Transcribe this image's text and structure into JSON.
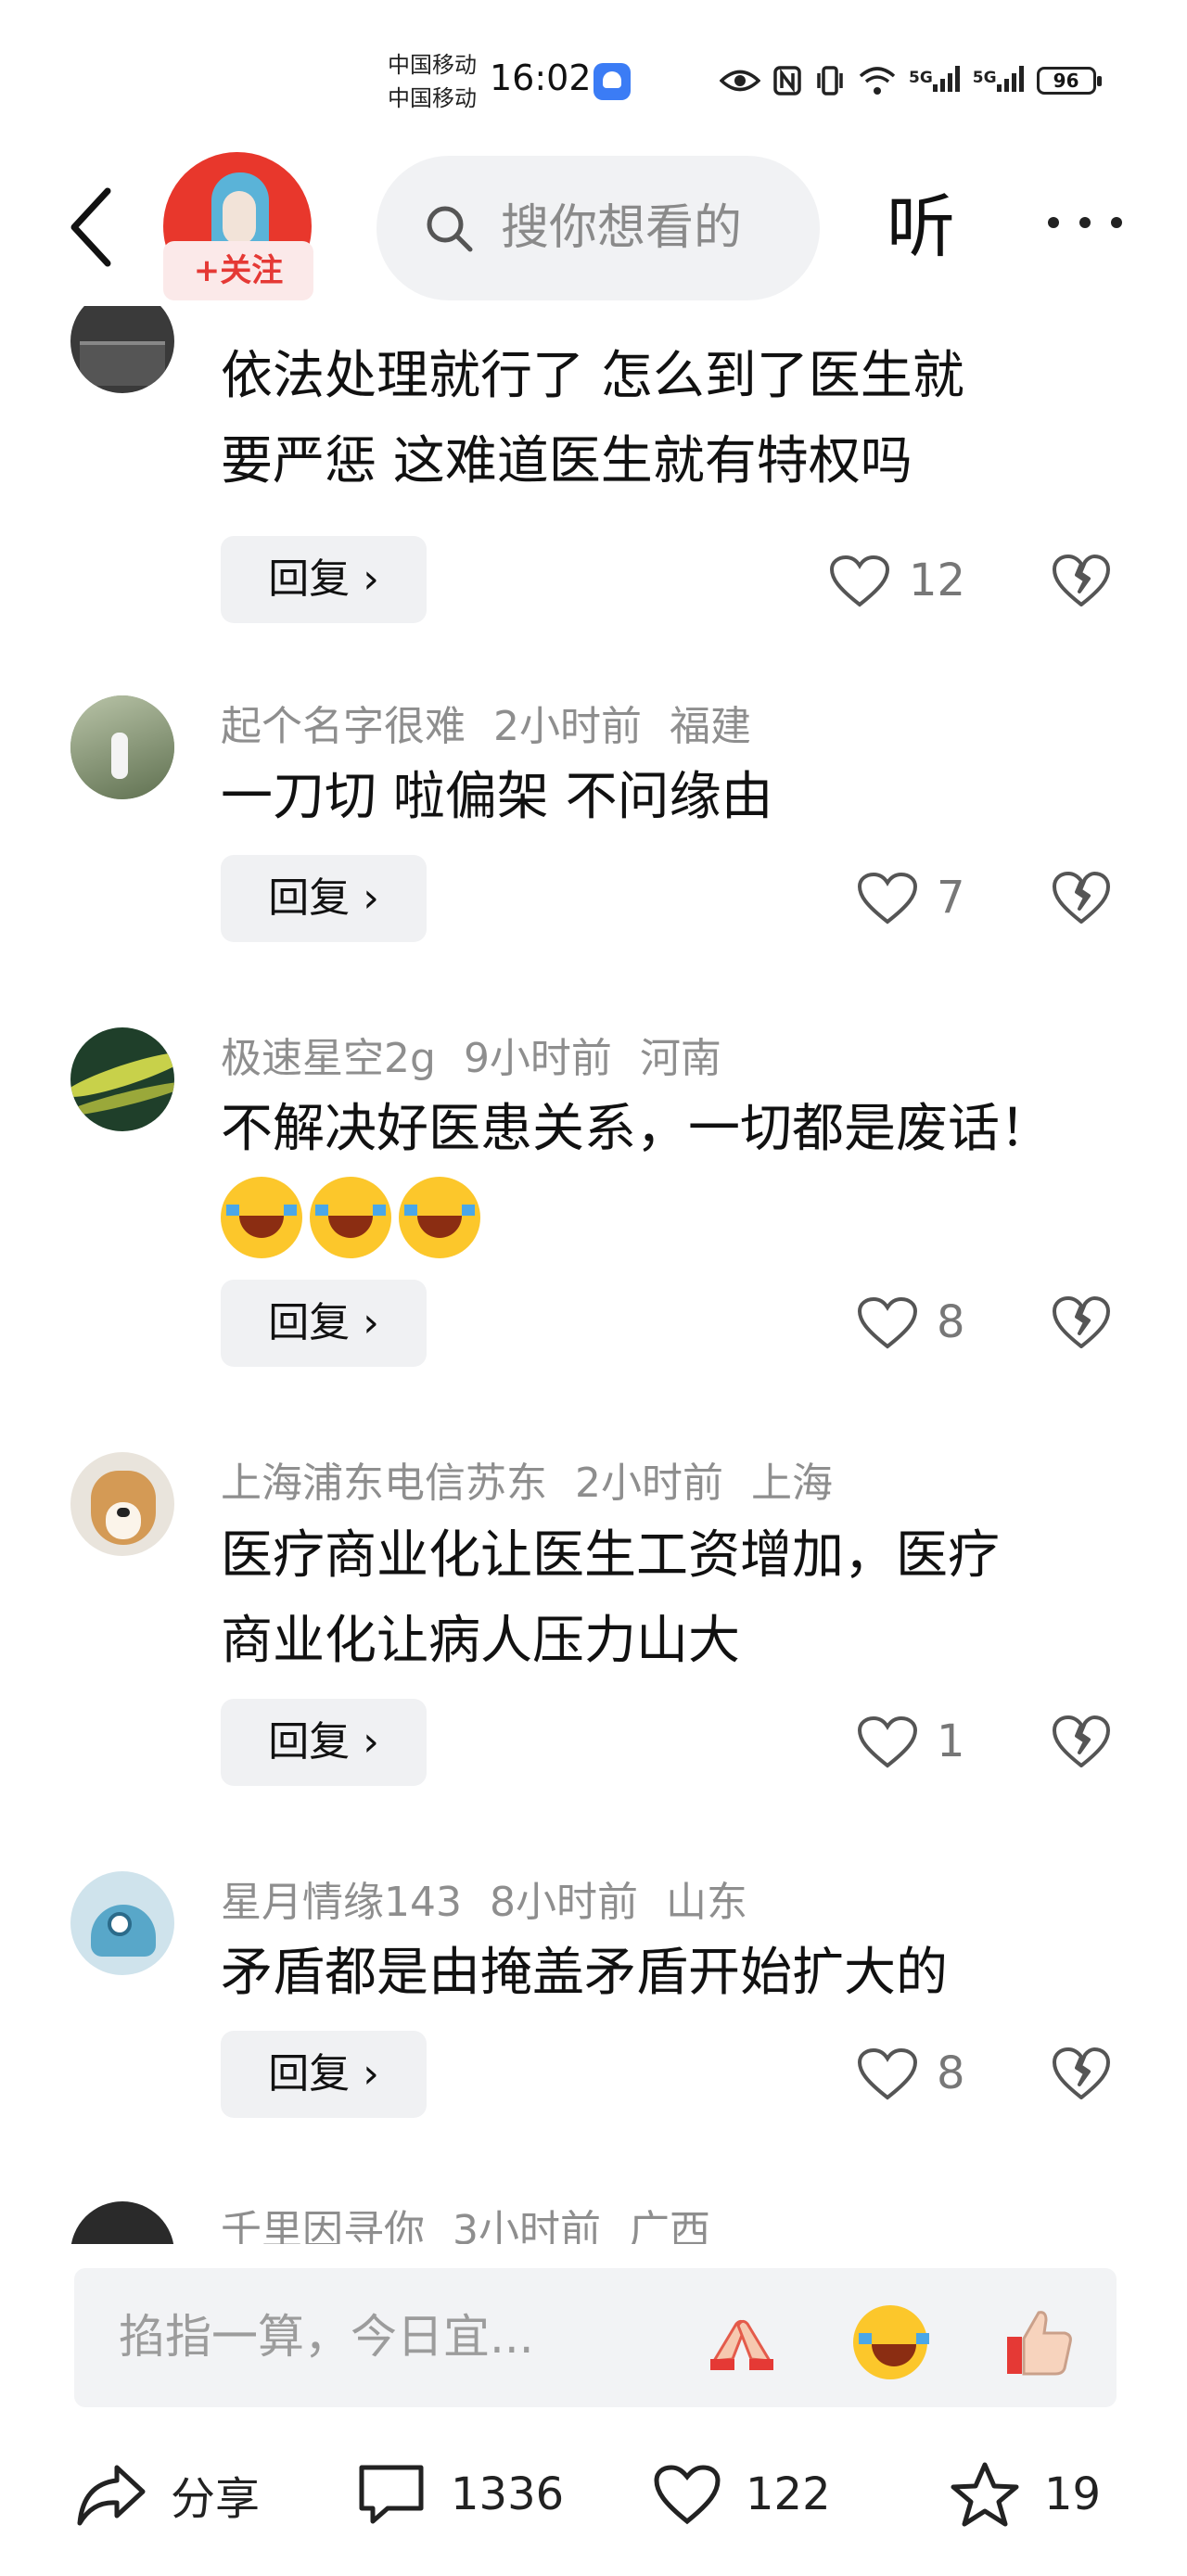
{
  "status_bar": {
    "carrier_1": "中国移动",
    "carrier_2": "中国移动",
    "time": "16:02",
    "network_1": "5G",
    "network_2": "5G",
    "battery": "96",
    "icons": [
      "app-notification-icon",
      "eye-icon",
      "nfc-icon",
      "vibrate-icon",
      "wifi-icon",
      "signal-icon",
      "battery-icon"
    ]
  },
  "header": {
    "follow_label": "+关注",
    "search_placeholder": "搜你想看的",
    "listen_label": "听"
  },
  "comments": [
    {
      "user": "",
      "time": "",
      "location": "",
      "text_lines": [
        "依法处理就行了 怎么到了医生就",
        "要严惩 这难道医生就有特权吗"
      ],
      "reply_label": "回复 ›",
      "likes": "12",
      "avatar_color": "#3a3a3a"
    },
    {
      "user": "起个名字很难",
      "time": "2小时前",
      "location": "福建",
      "text_lines": [
        "一刀切 啦偏架 不问缘由"
      ],
      "reply_label": "回复 ›",
      "likes": "7",
      "avatar_color": "#7c8a6a"
    },
    {
      "user": "极速星空2g",
      "time": "9小时前",
      "location": "河南",
      "text_lines": [
        "不解决好医患关系，一切都是废话！"
      ],
      "emoji": [
        "laughing-crying-emoji",
        "laughing-crying-emoji",
        "laughing-crying-emoji"
      ],
      "reply_label": "回复 ›",
      "likes": "8",
      "avatar_color": "#1f3f2a"
    },
    {
      "user": "上海浦东电信苏东",
      "time": "2小时前",
      "location": "上海",
      "text_lines": [
        "医疗商业化让医生工资增加，医疗",
        "商业化让病人压力山大"
      ],
      "reply_label": "回复 ›",
      "likes": "1",
      "avatar_color": "#d9a86b"
    },
    {
      "user": "星月情缘143",
      "time": "8小时前",
      "location": "山东",
      "text_lines": [
        "矛盾都是由掩盖矛盾开始扩大的"
      ],
      "reply_label": "回复 ›",
      "likes": "8",
      "avatar_color": "#cfe3ec"
    },
    {
      "user": "千里因寻你",
      "time": "3小时前",
      "location": "广西",
      "text_lines": [],
      "avatar_color": "#2a2a2a"
    }
  ],
  "input_bar": {
    "placeholder": "掐指一算，今日宜...",
    "quick_emojis": [
      "clapping-hands-emoji",
      "laughing-crying-emoji",
      "thumbs-up-emoji"
    ]
  },
  "action_bar": {
    "share_label": "分享",
    "comment_count": "1336",
    "like_count": "122",
    "favorite_count": "19"
  }
}
